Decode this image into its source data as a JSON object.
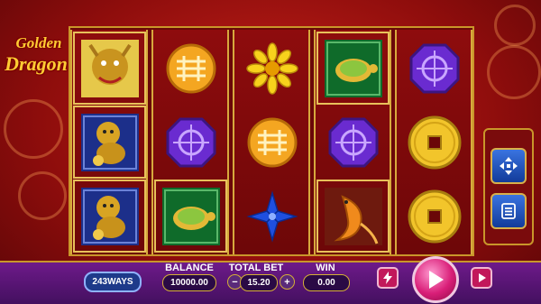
{
  "logo": {
    "line1": "Golden",
    "line2": "Dragon"
  },
  "reels": [
    [
      "golden-dragon",
      "golden-lion",
      "golden-lion"
    ],
    [
      "gold-medallion",
      "purple-octagon",
      "jade-turtle"
    ],
    [
      "gold-flower",
      "gold-medallion",
      "blue-flower"
    ],
    [
      "jade-turtle",
      "purple-octagon",
      "gold-koi"
    ],
    [
      "purple-octagon",
      "gold-coin",
      "gold-coin"
    ]
  ],
  "highlighted": [
    "0-0",
    "0-1",
    "0-2",
    "1-2",
    "3-0",
    "3-2"
  ],
  "controls": {
    "ways": "243WAYS",
    "balance_label": "BALANCE",
    "balance": "10000.00",
    "totalbet_label": "TOTAL BET",
    "totalbet": "15.20",
    "minus": "−",
    "plus": "+",
    "win_label": "WIN",
    "win": "0.00"
  },
  "side_buttons": [
    "move-icon",
    "menu-icon"
  ],
  "colors": {
    "accent_gold": "#d4af37",
    "spin": "#d91e78",
    "panel": "#6a0708"
  }
}
